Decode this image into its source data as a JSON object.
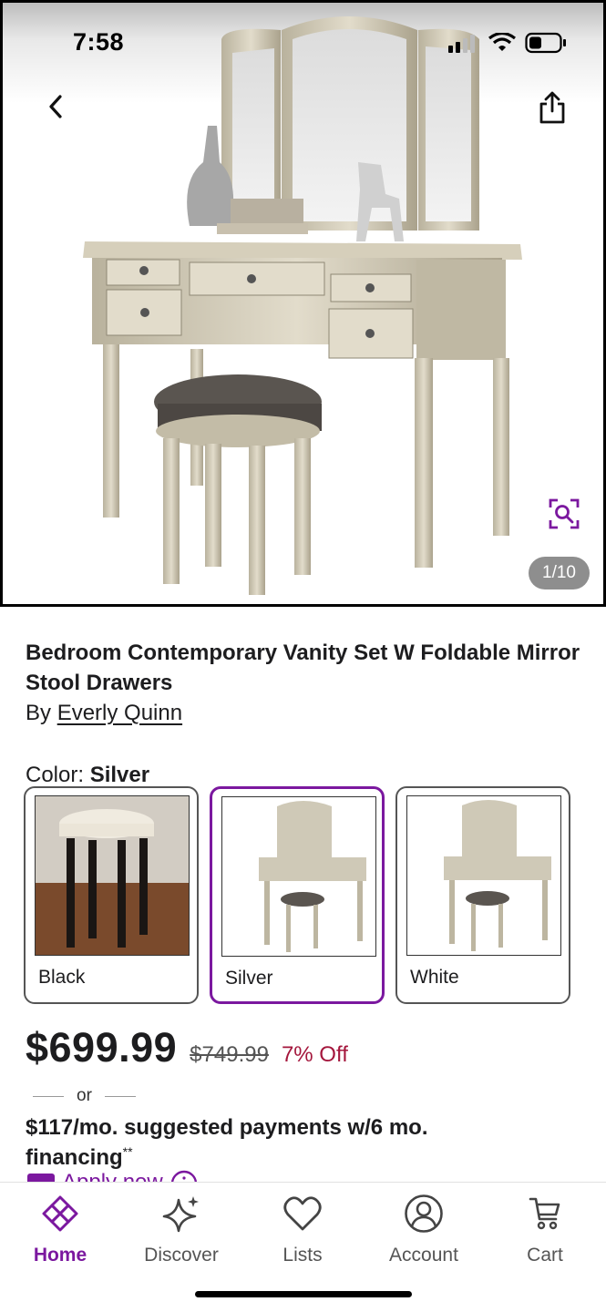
{
  "status_bar": {
    "time": "7:58"
  },
  "gallery": {
    "counter": "1/10"
  },
  "product": {
    "title": "Bedroom Contemporary Vanity Set W Foldable Mirror Stool Drawers",
    "by_prefix": "By",
    "brand": "Everly Quinn",
    "color_label": "Color:",
    "selected_color": "Silver"
  },
  "swatches": [
    {
      "name": "Black",
      "selected": false
    },
    {
      "name": "Silver",
      "selected": true
    },
    {
      "name": "White",
      "selected": false
    }
  ],
  "pricing": {
    "price": "$699.99",
    "original_price": "$749.99",
    "discount": "7% Off",
    "or_text": "or",
    "financing": "$117/mo. suggested payments w/6 mo. financing",
    "financing_mark": "**",
    "apply_now": "Apply now"
  },
  "tabs": [
    {
      "label": "Home",
      "icon": "home-icon",
      "active": true
    },
    {
      "label": "Discover",
      "icon": "sparkle-icon",
      "active": false
    },
    {
      "label": "Lists",
      "icon": "heart-icon",
      "active": false
    },
    {
      "label": "Account",
      "icon": "account-icon",
      "active": false
    },
    {
      "label": "Cart",
      "icon": "cart-icon",
      "active": false
    }
  ],
  "colors": {
    "brand_purple": "#7b189f",
    "discount_red": "#a4163c",
    "text": "#1d1d1f",
    "vanity_silver": "#c9c2ad"
  }
}
